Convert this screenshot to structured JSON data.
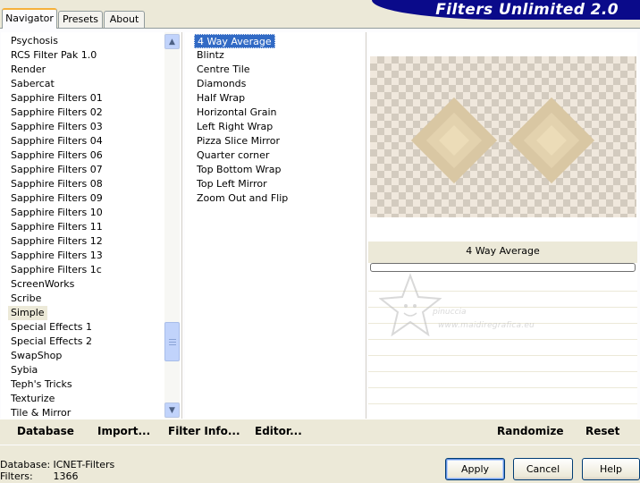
{
  "tabs": [
    {
      "label": "Navigator",
      "active": true
    },
    {
      "label": "Presets",
      "active": false
    },
    {
      "label": "About",
      "active": false
    }
  ],
  "app_title": "Filters Unlimited 2.0",
  "categories": [
    "Psychosis",
    "RCS Filter Pak 1.0",
    "Render",
    "Sabercat",
    "Sapphire Filters 01",
    "Sapphire Filters 02",
    "Sapphire Filters 03",
    "Sapphire Filters 04",
    "Sapphire Filters 06",
    "Sapphire Filters 07",
    "Sapphire Filters 08",
    "Sapphire Filters 09",
    "Sapphire Filters 10",
    "Sapphire Filters 11",
    "Sapphire Filters 12",
    "Sapphire Filters 13",
    "Sapphire Filters 1c",
    "ScreenWorks",
    "Scribe",
    "Simple",
    "Special Effects 1",
    "Special Effects 2",
    "SwapShop",
    "Sybia",
    "Teph's Tricks",
    "Texturize",
    "Tile & Mirror"
  ],
  "selected_category": "Simple",
  "filters": [
    "4 Way Average",
    "Blintz",
    "Centre Tile",
    "Diamonds",
    "Half Wrap",
    "Horizontal Grain",
    "Left Right Wrap",
    "Pizza Slice Mirror",
    "Quarter corner",
    "Top Bottom Wrap",
    "Top Left Mirror",
    "Zoom Out and Flip"
  ],
  "selected_filter": "4 Way Average",
  "preview": {
    "filter_name": "4 Way Average",
    "watermark_line1": "pinuccia",
    "watermark_line2": "www.maidiregrafica.eu"
  },
  "actions": {
    "database": "Database",
    "import": "Import...",
    "filter_info": "Filter Info...",
    "editor": "Editor...",
    "randomize": "Randomize",
    "reset": "Reset"
  },
  "status": {
    "database_label": "Database:",
    "database_value": "ICNET-Filters",
    "filters_label": "Filters:",
    "filters_value": "1366"
  },
  "buttons": {
    "apply": "Apply",
    "cancel": "Cancel",
    "help": "Help"
  },
  "colors": {
    "title_banner": "#0a0a8a",
    "selection": "#316ac5",
    "diamond_outer": "#d9c7a3",
    "diamond_inner": "#ecdcb8",
    "window_bg": "#ece9d8"
  },
  "icons": {
    "scroll_up": "chevron-up-icon",
    "scroll_down": "chevron-down-icon",
    "watermark": "star-icon"
  }
}
